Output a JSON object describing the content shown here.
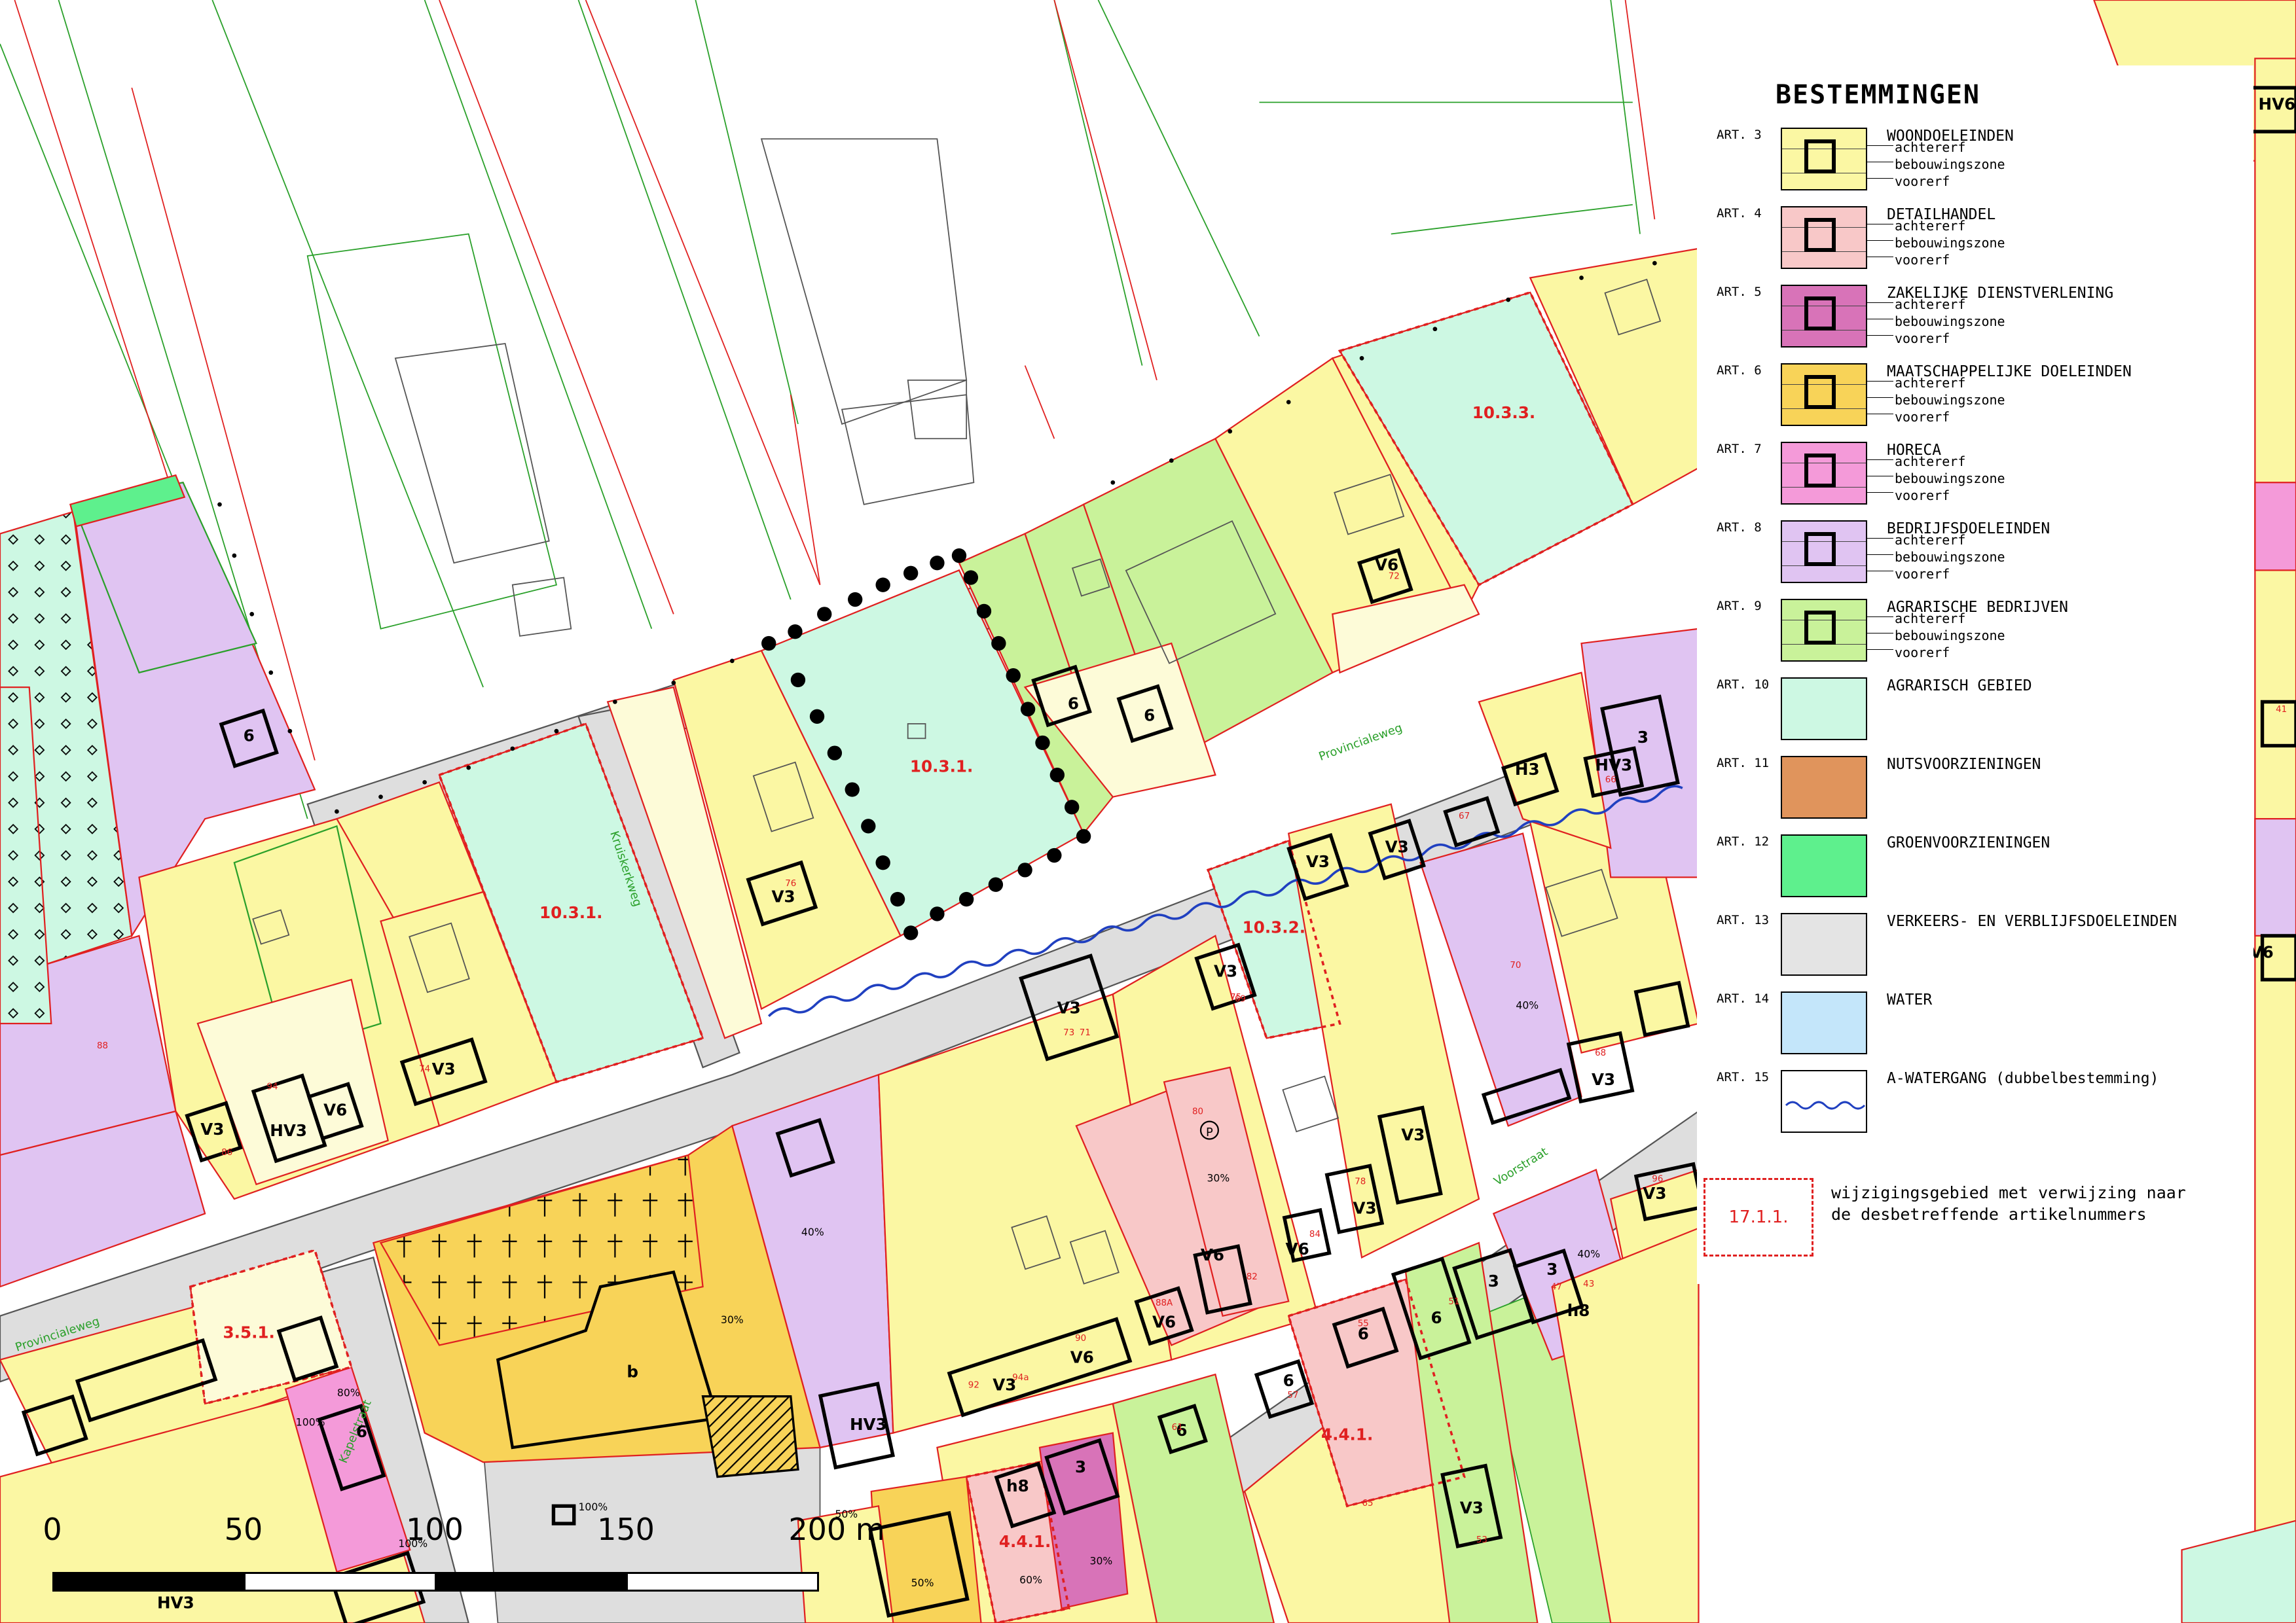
{
  "legend": {
    "title": "BESTEMMINGEN",
    "sub_labels": {
      "a": "achtererf",
      "b": "bebouwingszone",
      "c": "voorerf"
    },
    "items": [
      {
        "art": "ART. 3",
        "name": "WOONDOELEINDEN",
        "color": "#fbf7a3",
        "zoned": true
      },
      {
        "art": "ART. 4",
        "name": "DETAILHANDEL",
        "color": "#f8c8c8",
        "zoned": true
      },
      {
        "art": "ART. 5",
        "name": "ZAKELIJKE DIENSTVERLENING",
        "color": "#d873b8",
        "zoned": true
      },
      {
        "art": "ART. 6",
        "name": "MAATSCHAPPELIJKE DOELEINDEN",
        "color": "#f8d358",
        "zoned": true
      },
      {
        "art": "ART. 7",
        "name": "HORECA",
        "color": "#f49ad9",
        "zoned": true
      },
      {
        "art": "ART. 8",
        "name": "BEDRIJFSDOELEINDEN",
        "color": "#e0c4f2",
        "zoned": true
      },
      {
        "art": "ART. 9",
        "name": "AGRARISCHE BEDRIJVEN",
        "color": "#c9f29a",
        "zoned": true
      },
      {
        "art": "ART. 10",
        "name": "AGRARISCH GEBIED",
        "color": "#cdf8e3",
        "zoned": false
      },
      {
        "art": "ART. 11",
        "name": "NUTSVOORZIENINGEN",
        "color": "#e0945c",
        "zoned": false
      },
      {
        "art": "ART. 12",
        "name": "GROENVOORZIENINGEN",
        "color": "#5ef08d",
        "zoned": false
      },
      {
        "art": "ART. 13",
        "name": "VERKEERS- EN VERBLIJFSDOELEINDEN",
        "color": "#e4e4e4",
        "zoned": false
      },
      {
        "art": "ART. 14",
        "name": "WATER",
        "color": "#c4e6fa",
        "zoned": false
      },
      {
        "art": "ART. 15",
        "name": "A-WATERGANG (dubbelbestemming)",
        "color": "#ffffff",
        "zoned": false,
        "wavy": true
      }
    ],
    "note": {
      "box_label": "17.1.1.",
      "text_line1": "wijzigingsgebied met verwijzing naar",
      "text_line2": "de desbetreffende artikelnummers"
    }
  },
  "scale_bar": {
    "labels": [
      "0",
      "50",
      "100",
      "150",
      "200 m"
    ]
  },
  "map": {
    "colors": {
      "road": "#dedede",
      "residential": "#fbf7a3",
      "residential_pale": "#fdfbd8",
      "retail": "#f8c8c8",
      "service": "#d873b8",
      "social": "#f8d358",
      "horeca": "#f49ad9",
      "business": "#e0c4f2",
      "farm": "#c9f29a",
      "agri": "#cdf8e3",
      "green": "#5ef08d",
      "water": "#2040c0",
      "boundary": "#e02020",
      "fine_line": "#2aa02a"
    },
    "street_labels": [
      "Provincialeweg",
      "Provincialeweg",
      "Kruiskerkweg",
      "Voorstraat",
      "Kapelstraat"
    ],
    "change_areas": [
      "10.3.1.",
      "10.3.1.",
      "10.3.2.",
      "10.3.3.",
      "3.5.1.",
      "4.4.1.",
      "4.4.1."
    ],
    "building_codes": [
      "V3",
      "V3",
      "V3",
      "V3",
      "V3",
      "V3",
      "V3",
      "V3",
      "V3",
      "V3",
      "V3",
      "V3",
      "V3",
      "V6",
      "V6",
      "V6",
      "V6",
      "V6",
      "V6",
      "H3",
      "HV3",
      "HV3",
      "HV3",
      "HV3",
      "HV6",
      "HV6",
      "3",
      "3",
      "3",
      "3",
      "6",
      "6",
      "6",
      "6",
      "6",
      "6",
      "6",
      "6",
      "h8",
      "h8",
      "b"
    ],
    "house_numbers": [
      "76",
      "73",
      "75",
      "71",
      "69",
      "68",
      "66",
      "67",
      "70",
      "72",
      "74",
      "80",
      "82",
      "84",
      "86",
      "88",
      "88A",
      "90",
      "92",
      "94",
      "96",
      "94a",
      "78",
      "41",
      "43",
      "47",
      "51",
      "53",
      "55",
      "57",
      "61",
      "65"
    ],
    "percentages": [
      "40%",
      "40%",
      "30%",
      "30%",
      "50%",
      "80%",
      "100%",
      "100%",
      "100%",
      "60%",
      "50%",
      "30%",
      "40%"
    ],
    "parking_symbol": "P"
  }
}
